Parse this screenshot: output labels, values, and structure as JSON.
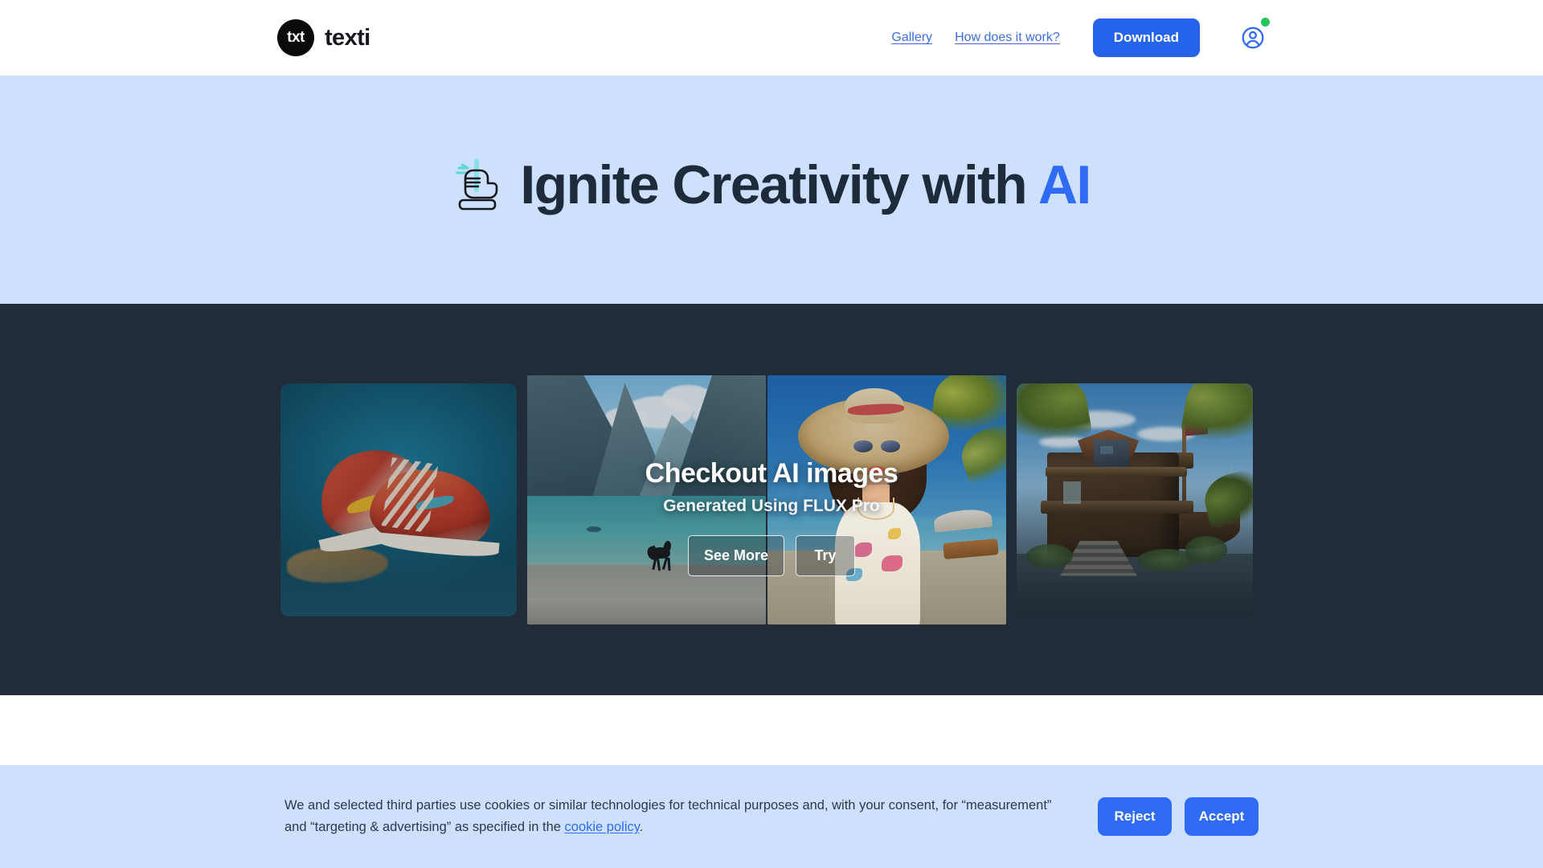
{
  "header": {
    "brand": {
      "mark_text": "txt",
      "name": "texti"
    },
    "nav_links": [
      {
        "label": "Gallery"
      },
      {
        "label": "How does it work?"
      }
    ],
    "download_label": "Download",
    "account_icon": "user-circle-icon",
    "status_dot_color": "#22c55e"
  },
  "hero": {
    "icon": "hand-pressing-button-icon",
    "title_main": "Ignite Creativity with ",
    "title_accent": "AI",
    "background_color": "#cde0fd",
    "accent_color": "#2f6bf5"
  },
  "gallery": {
    "background_color": "#222c38",
    "overlay": {
      "title": "Checkout AI images",
      "subtitle": "Generated Using FLUX Pro",
      "primary_button": "See More",
      "secondary_button": "Try"
    },
    "images": [
      {
        "alt": "Colorful red and yellow AI generated sneakers on teal background"
      },
      {
        "alt": "Mountain fjord lake with black horse running on the shore"
      },
      {
        "alt": "Woman in straw sun hat and sunglasses on a tropical beach"
      },
      {
        "alt": "Ornate wooden mansion built like a pirate ship among palm trees"
      }
    ]
  },
  "cookie_banner": {
    "text_before_link": "We and selected third parties use cookies or similar technologies for technical purposes and, with your consent, for “measurement” and “targeting & advertising” as specified in the ",
    "link_label": "cookie policy",
    "text_after_link": ".",
    "reject_label": "Reject",
    "accept_label": "Accept",
    "background_color": "#cde0fd",
    "button_color": "#2f6bf5"
  }
}
